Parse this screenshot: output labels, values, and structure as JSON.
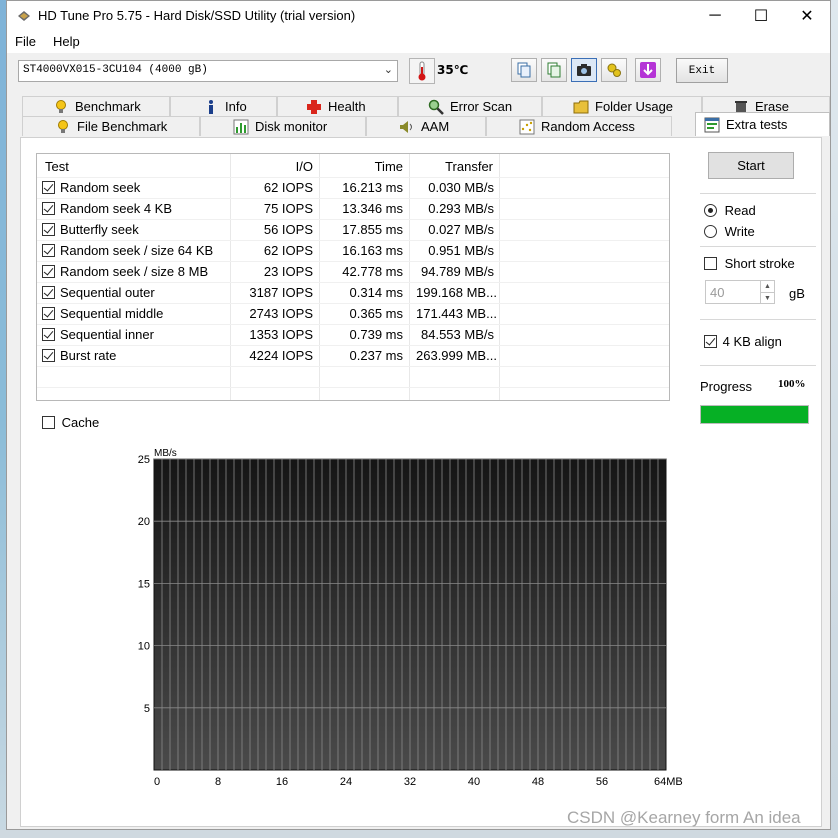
{
  "window": {
    "title": "HD Tune Pro 5.75 - Hard Disk/SSD Utility (trial version)",
    "minimize": "─",
    "maximize": "☐",
    "close": "✕"
  },
  "menu": {
    "file": "File",
    "help": "Help"
  },
  "toolbar": {
    "drive": "ST4000VX015-3CU104 (4000 gB)",
    "temperature": "35℃",
    "exit": "Exit"
  },
  "tabs_row1": [
    "Benchmark",
    "Info",
    "Health",
    "Error Scan",
    "Folder Usage",
    "Erase"
  ],
  "tabs_row2": [
    "File Benchmark",
    "Disk monitor",
    "AAM",
    "Random Access",
    "Extra tests"
  ],
  "table": {
    "headers": [
      "Test",
      "I/O",
      "Time",
      "Transfer"
    ],
    "rows": [
      {
        "test": "Random seek",
        "io": "62 IOPS",
        "time": "16.213 ms",
        "transfer": "0.030 MB/s"
      },
      {
        "test": "Random seek 4 KB",
        "io": "75 IOPS",
        "time": "13.346 ms",
        "transfer": "0.293 MB/s"
      },
      {
        "test": "Butterfly seek",
        "io": "56 IOPS",
        "time": "17.855 ms",
        "transfer": "0.027 MB/s"
      },
      {
        "test": "Random seek / size 64 KB",
        "io": "62 IOPS",
        "time": "16.163 ms",
        "transfer": "0.951 MB/s"
      },
      {
        "test": "Random seek / size 8 MB",
        "io": "23 IOPS",
        "time": "42.778 ms",
        "transfer": "94.789 MB/s"
      },
      {
        "test": "Sequential outer",
        "io": "3187 IOPS",
        "time": "0.314 ms",
        "transfer": "199.168 MB..."
      },
      {
        "test": "Sequential middle",
        "io": "2743 IOPS",
        "time": "0.365 ms",
        "transfer": "171.443 MB..."
      },
      {
        "test": "Sequential inner",
        "io": "1353 IOPS",
        "time": "0.739 ms",
        "transfer": "84.553 MB/s"
      },
      {
        "test": "Burst rate",
        "io": "4224 IOPS",
        "time": "0.237 ms",
        "transfer": "263.999 MB..."
      }
    ]
  },
  "options": {
    "start": "Start",
    "read": "Read",
    "write": "Write",
    "short_stroke": "Short stroke",
    "stroke_value": "40",
    "stroke_unit": "gB",
    "align": "4 KB align",
    "progress_label": "Progress",
    "progress_text": "100%",
    "progress_fraction": 1.0,
    "cache": "Cache"
  },
  "colors": {
    "progress": "#06b025",
    "chart_bg": "#2a2a2a",
    "chart_grid": "#8a8a8a",
    "accent": "#0078d7"
  },
  "chart_data": {
    "type": "line",
    "ylabel": "MB/s",
    "ylim": [
      0,
      25
    ],
    "yticks": [
      "25",
      "20",
      "15",
      "10",
      "5"
    ],
    "xlim": [
      0,
      64
    ],
    "xticks": [
      "0",
      "8",
      "16",
      "24",
      "32",
      "40",
      "48",
      "56",
      "64MB"
    ],
    "series": [],
    "grid": true
  },
  "watermark": "CSDN @Kearney form An idea"
}
